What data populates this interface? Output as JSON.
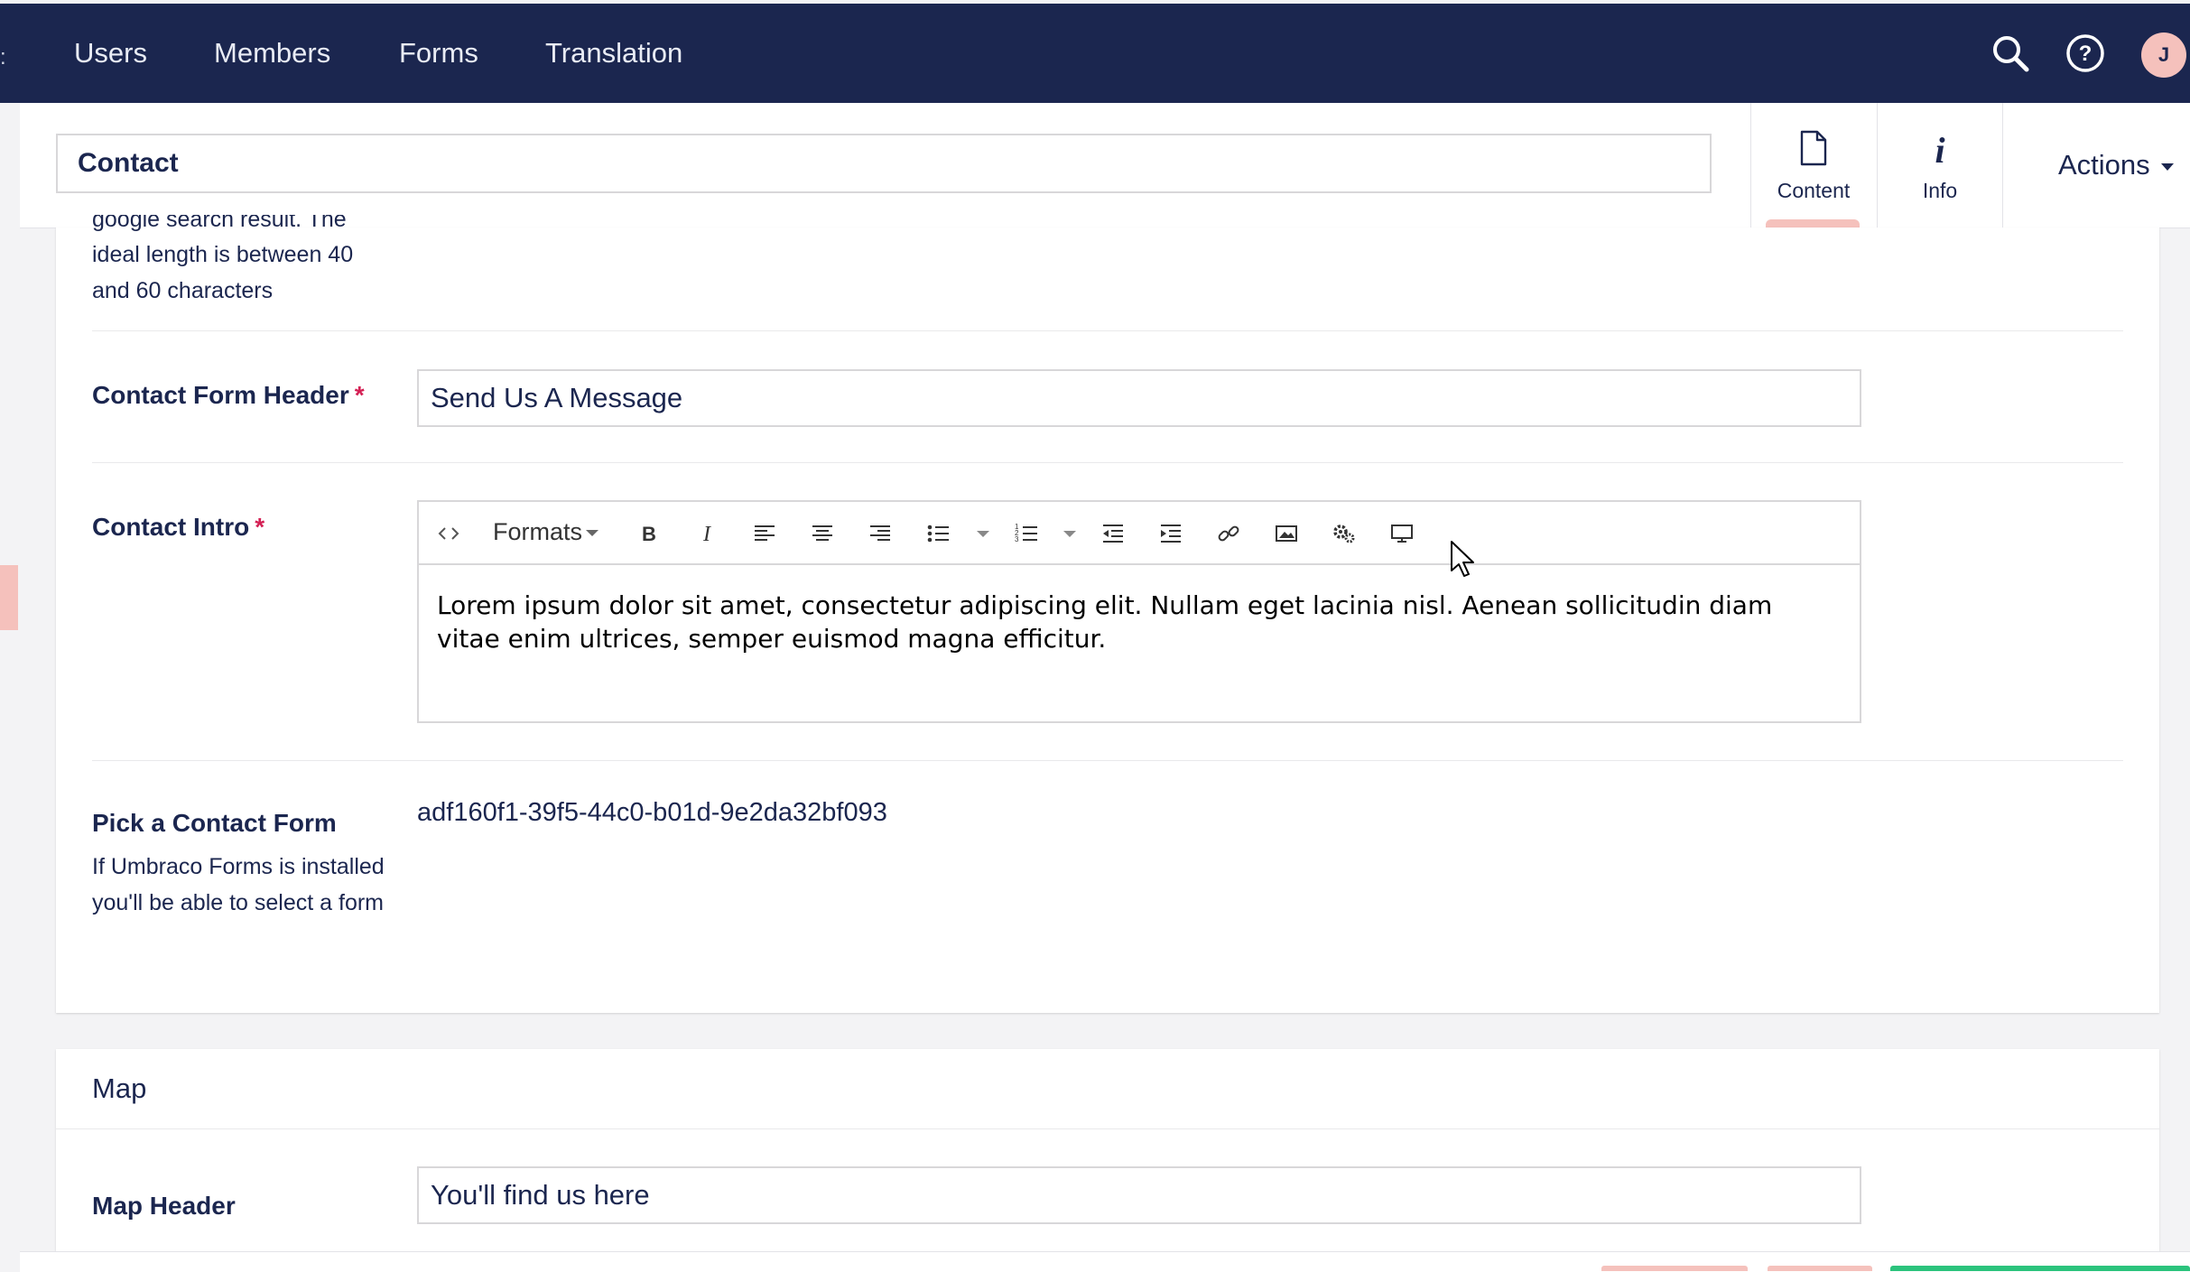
{
  "nav": {
    "items": [
      "Users",
      "Members",
      "Forms",
      "Translation"
    ],
    "avatar_initial": "J"
  },
  "editor": {
    "name_value": "Contact",
    "tabs": [
      {
        "label": "Content",
        "icon": "document-icon",
        "active": true
      },
      {
        "label": "Info",
        "icon": "info-icon",
        "active": false
      }
    ],
    "actions_label": "Actions"
  },
  "content": {
    "seo_description_lines": [
      "google search result. The",
      "ideal length is between 40",
      "and 60 characters"
    ],
    "contact_form_header": {
      "label": "Contact Form Header",
      "required": "*",
      "value": "Send Us A Message"
    },
    "contact_intro": {
      "label": "Contact Intro",
      "required": "*",
      "toolbar": {
        "formats_label": "Formats"
      },
      "text": "Lorem ipsum dolor sit amet, consectetur adipiscing elit. Nullam eget lacinia nisl. Aenean sollicitudin diam vitae enim ultrices, semper euismod magna efficitur."
    },
    "pick_contact_form": {
      "label": "Pick a Contact Form",
      "description": "If Umbraco Forms is installed you'll be able to select a form",
      "value": "adf160f1-39f5-44c0-b01d-9e2da32bf093"
    }
  },
  "map": {
    "title": "Map",
    "map_header": {
      "label": "Map Header",
      "value": "You'll find us here"
    }
  },
  "colors": {
    "nav_bg": "#1b264f",
    "accent": "#f5c1bc",
    "required": "#d42054",
    "success": "#2bc37c"
  }
}
